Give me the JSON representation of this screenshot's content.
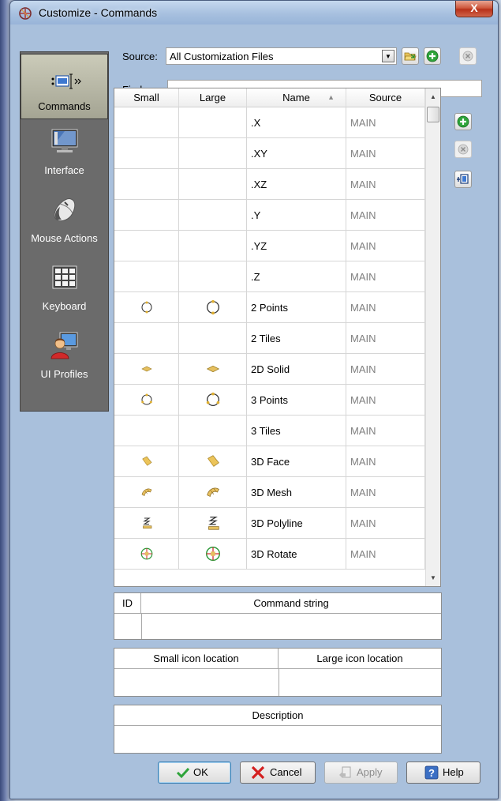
{
  "window": {
    "title": "Customize - Commands",
    "close_label": "X"
  },
  "source": {
    "label": "Source:",
    "value": "All Customization Files"
  },
  "find": {
    "label": "Find:",
    "value": ""
  },
  "nav": {
    "items": [
      {
        "label": "Commands",
        "icon": "commands-icon",
        "active": true
      },
      {
        "label": "Interface",
        "icon": "monitor-icon",
        "active": false
      },
      {
        "label": "Mouse Actions",
        "icon": "mouse-icon",
        "active": false
      },
      {
        "label": "Keyboard",
        "icon": "keyboard-icon",
        "active": false
      },
      {
        "label": "UI Profiles",
        "icon": "user-profile-icon",
        "active": false
      }
    ]
  },
  "grid": {
    "columns": [
      "Small",
      "Large",
      "Name",
      "Source"
    ],
    "rows": [
      {
        "small_icon": "",
        "large_icon": "",
        "name": ".X",
        "source": "MAIN"
      },
      {
        "small_icon": "",
        "large_icon": "",
        "name": ".XY",
        "source": "MAIN"
      },
      {
        "small_icon": "",
        "large_icon": "",
        "name": ".XZ",
        "source": "MAIN"
      },
      {
        "small_icon": "",
        "large_icon": "",
        "name": ".Y",
        "source": "MAIN"
      },
      {
        "small_icon": "",
        "large_icon": "",
        "name": ".YZ",
        "source": "MAIN"
      },
      {
        "small_icon": "",
        "large_icon": "",
        "name": ".Z",
        "source": "MAIN"
      },
      {
        "small_icon": "circle-2-points-icon",
        "large_icon": "circle-2-points-icon",
        "name": "2 Points",
        "source": "MAIN"
      },
      {
        "small_icon": "",
        "large_icon": "",
        "name": "2 Tiles",
        "source": "MAIN"
      },
      {
        "small_icon": "solid-2d-icon",
        "large_icon": "solid-2d-icon",
        "name": "2D Solid",
        "source": "MAIN"
      },
      {
        "small_icon": "circle-3-points-icon",
        "large_icon": "circle-3-points-icon",
        "name": "3 Points",
        "source": "MAIN"
      },
      {
        "small_icon": "",
        "large_icon": "",
        "name": "3 Tiles",
        "source": "MAIN"
      },
      {
        "small_icon": "face-3d-icon",
        "large_icon": "face-3d-icon",
        "name": "3D Face",
        "source": "MAIN"
      },
      {
        "small_icon": "mesh-3d-icon",
        "large_icon": "mesh-3d-icon",
        "name": "3D Mesh",
        "source": "MAIN"
      },
      {
        "small_icon": "polyline-3d-icon",
        "large_icon": "polyline-3d-icon",
        "name": "3D Polyline",
        "source": "MAIN"
      },
      {
        "small_icon": "rotate-3d-icon",
        "large_icon": "rotate-3d-icon",
        "name": "3D Rotate",
        "source": "MAIN"
      }
    ]
  },
  "command_panel": {
    "col_id": "ID",
    "col_string": "Command string"
  },
  "icon_panel": {
    "col_small": "Small icon location",
    "col_large": "Large icon location"
  },
  "description_panel": {
    "title": "Description"
  },
  "buttons": {
    "ok": "OK",
    "cancel": "Cancel",
    "apply": "Apply",
    "help": "Help"
  },
  "colors": {
    "accent_green": "#2ea43a",
    "cancel_red": "#d42020",
    "help_blue": "#3b6fc4"
  }
}
